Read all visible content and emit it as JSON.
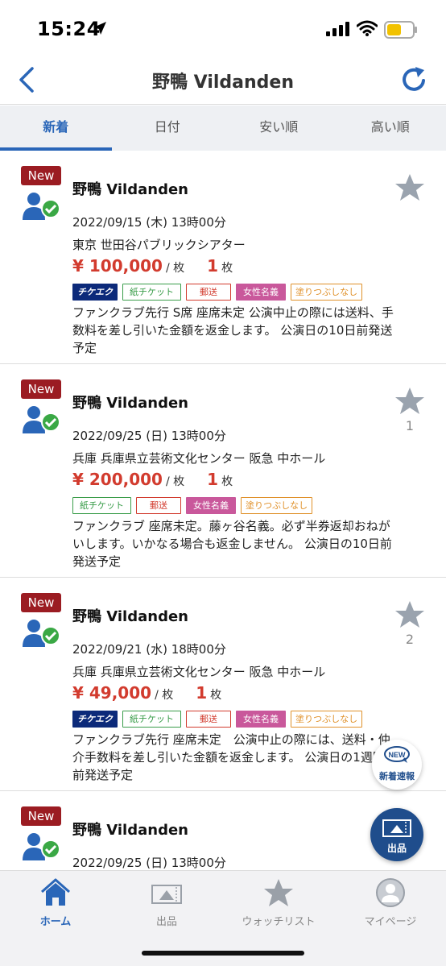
{
  "status_bar": {
    "time": "15:24"
  },
  "nav": {
    "title": "野鴨 Vildanden"
  },
  "tabs": [
    {
      "label": "新着",
      "active": true
    },
    {
      "label": "日付"
    },
    {
      "label": "安い順"
    },
    {
      "label": "高い順"
    }
  ],
  "items": [
    {
      "badge": "New",
      "title": "野鴨 Vildanden",
      "favorite_count": "",
      "date": "2022/09/15 (木) 13時00分",
      "venue": "東京 世田谷パブリックシアター",
      "price": "¥ 100,000",
      "per_unit": "/ 枚",
      "quantity": "1",
      "qty_unit": "枚",
      "tags": [
        "チケエク",
        "紙チケット",
        "郵送",
        "女性名義",
        "塗りつぶしなし"
      ],
      "description": "ファンクラブ先行 S席 座席未定 公演中止の際には送料、手数料を差し引いた金額を返金します。 公演日の10日前発送予定"
    },
    {
      "badge": "New",
      "title": "野鴨 Vildanden",
      "favorite_count": "1",
      "date": "2022/09/25 (日) 13時00分",
      "venue": "兵庫 兵庫県立芸術文化センター 阪急 中ホール",
      "price": "¥ 200,000",
      "per_unit": "/ 枚",
      "quantity": "1",
      "qty_unit": "枚",
      "tags": [
        "紙チケット",
        "郵送",
        "女性名義",
        "塗りつぶしなし"
      ],
      "description": "ファンクラブ 座席未定。藤ヶ谷名義。必ず半券返却おねがいします。いかなる場合も返金しません。 公演日の10日前発送予定"
    },
    {
      "badge": "New",
      "title": "野鴨 Vildanden",
      "favorite_count": "2",
      "date": "2022/09/21 (水) 18時00分",
      "venue": "兵庫 兵庫県立芸術文化センター 阪急 中ホール",
      "price": "¥ 49,000",
      "per_unit": "/ 枚",
      "quantity": "1",
      "qty_unit": "枚",
      "tags": [
        "チケエク",
        "紙チケット",
        "郵送",
        "女性名義",
        "塗りつぶしなし"
      ],
      "description": "ファンクラブ先行 座席未定　公演中止の際には、送料・仲介手数料を差し引いた金額を返金します。 公演日の1週間前発送予定"
    },
    {
      "badge": "New",
      "title": "野鴨 Vildanden",
      "favorite_count": "",
      "date": "2022/09/25 (日) 13時00分"
    }
  ],
  "fab": {
    "new_label": "新着速報",
    "new_icon_text": "NEW",
    "sell_label": "出品"
  },
  "bottom_tabs": [
    {
      "label": "ホーム",
      "icon": "home-icon",
      "active": true
    },
    {
      "label": "出品",
      "icon": "ticket-icon"
    },
    {
      "label": "ウォッチリスト",
      "icon": "star-icon"
    },
    {
      "label": "マイページ",
      "icon": "person-icon"
    }
  ],
  "colors": {
    "accent": "#2a66b8",
    "price": "#d23b2e",
    "badge": "#9b1c22",
    "fab": "#1f4d8c"
  }
}
